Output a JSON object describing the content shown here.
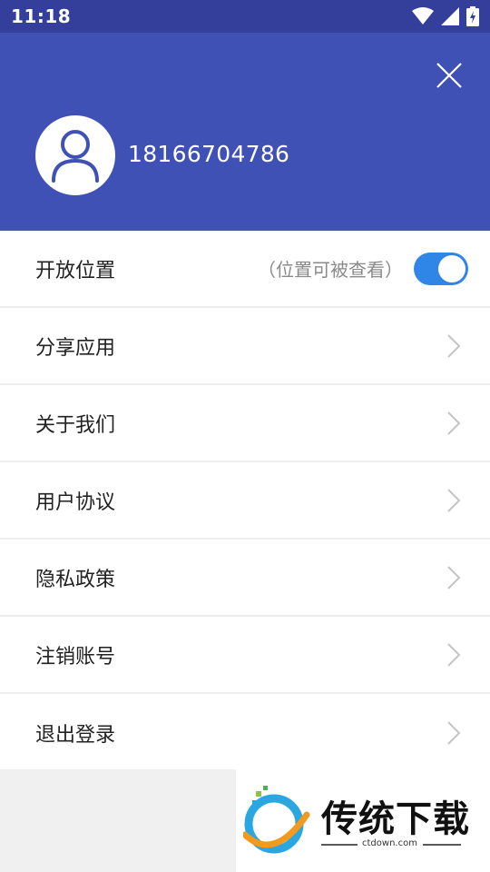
{
  "status_bar": {
    "time": "11:18",
    "icons": [
      "wifi-icon",
      "cellular-signal-icon",
      "battery-charging-icon"
    ]
  },
  "header": {
    "background_color": "#3f51b5",
    "username": "18166704786",
    "avatar_icon": "user-icon",
    "close_icon": "close-icon"
  },
  "menu": {
    "location": {
      "label": "开放位置",
      "hint": "（位置可被查看）",
      "enabled": true,
      "toggle_color": "#2f86e6"
    },
    "items": [
      {
        "label": "分享应用"
      },
      {
        "label": "关于我们"
      },
      {
        "label": "用户协议"
      },
      {
        "label": "隐私政策"
      },
      {
        "label": "注销账号"
      },
      {
        "label": "退出登录"
      }
    ]
  },
  "watermark": {
    "brand": "传统下载",
    "site": "ctdown.com"
  }
}
